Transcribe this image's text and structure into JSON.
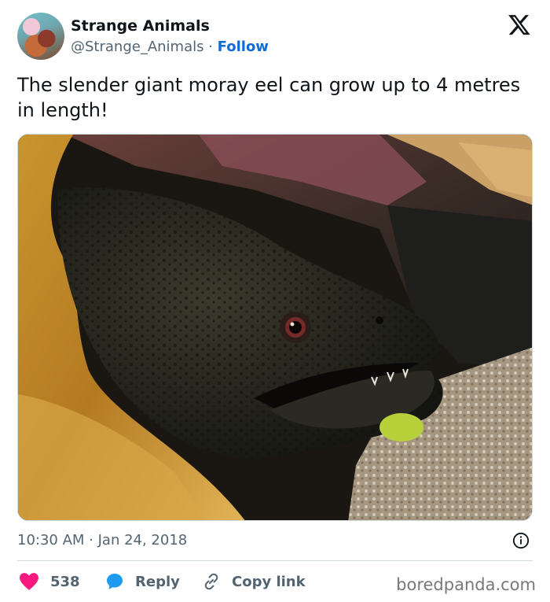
{
  "author": {
    "name": "Strange Animals",
    "handle": "@Strange_Animals",
    "separator": " · ",
    "follow_label": "Follow"
  },
  "tweet": {
    "text": "The slender giant moray eel can grow up to 4 metres in length!",
    "timestamp": "10:30 AM · Jan 24, 2018"
  },
  "actions": {
    "like_count": "538",
    "reply_label": "Reply",
    "copy_label": "Copy link"
  },
  "watermark": "boredpanda.com",
  "colors": {
    "like": "#f91880",
    "reply": "#1d9bf0",
    "link": "#0f6bd6",
    "muted": "#536471"
  },
  "icons": [
    "x-logo-icon",
    "heart-icon",
    "reply-bubble-icon",
    "link-icon",
    "info-icon"
  ]
}
